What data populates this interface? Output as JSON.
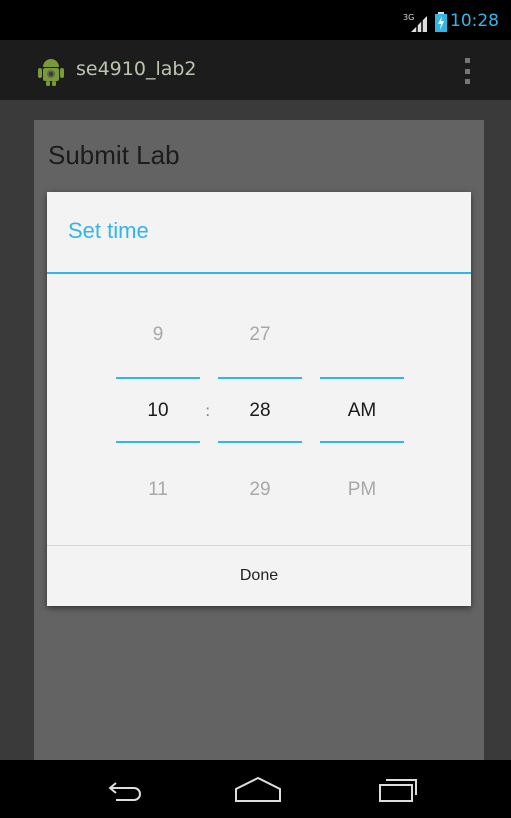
{
  "status_bar": {
    "time": "10:28",
    "network": "3G",
    "icons": [
      "signal-icon",
      "battery-charging-icon"
    ]
  },
  "action_bar": {
    "app_title": "se4910_lab2",
    "icons": [
      "android-app-icon",
      "overflow-menu-icon"
    ]
  },
  "page": {
    "title": "Submit Lab"
  },
  "dialog": {
    "title": "Set time",
    "separator": ":",
    "hour": {
      "prev": "9",
      "selected": "10",
      "next": "11"
    },
    "minute": {
      "prev": "27",
      "selected": "28",
      "next": "29"
    },
    "ampm": {
      "prev": "",
      "selected": "AM",
      "next": "PM"
    },
    "done_label": "Done",
    "accent_color": "#33b5e5"
  },
  "nav_bar": {
    "icons": [
      "back-icon",
      "home-icon",
      "recent-apps-icon"
    ]
  }
}
